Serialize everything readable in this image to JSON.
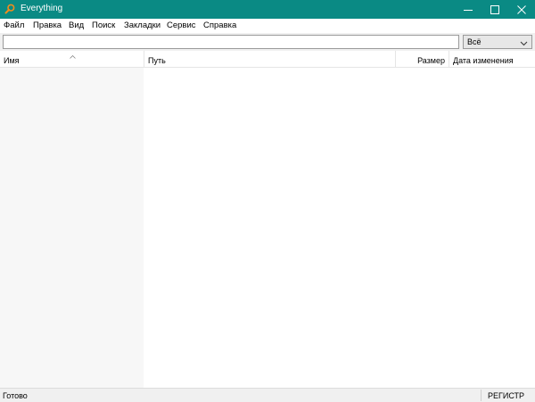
{
  "window": {
    "title": "Everything",
    "app_icon": "magnifier-icon",
    "controls": [
      "minimize-icon",
      "maximize-icon",
      "close-icon"
    ],
    "titlebar_color": "#0a8a84"
  },
  "menu": {
    "items": [
      "Файл",
      "Правка",
      "Вид",
      "Поиск",
      "Закладки",
      "Сервис",
      "Справка"
    ]
  },
  "search": {
    "value": "",
    "placeholder": ""
  },
  "filter": {
    "selected": "Всё"
  },
  "columns": {
    "name": "Имя",
    "path": "Путь",
    "size": "Размер",
    "date_modified": "Дата изменения",
    "sorted_by": "name",
    "sort_direction": "ascending"
  },
  "status": {
    "text": "Готово",
    "indicator": "РЕГИСТР"
  }
}
